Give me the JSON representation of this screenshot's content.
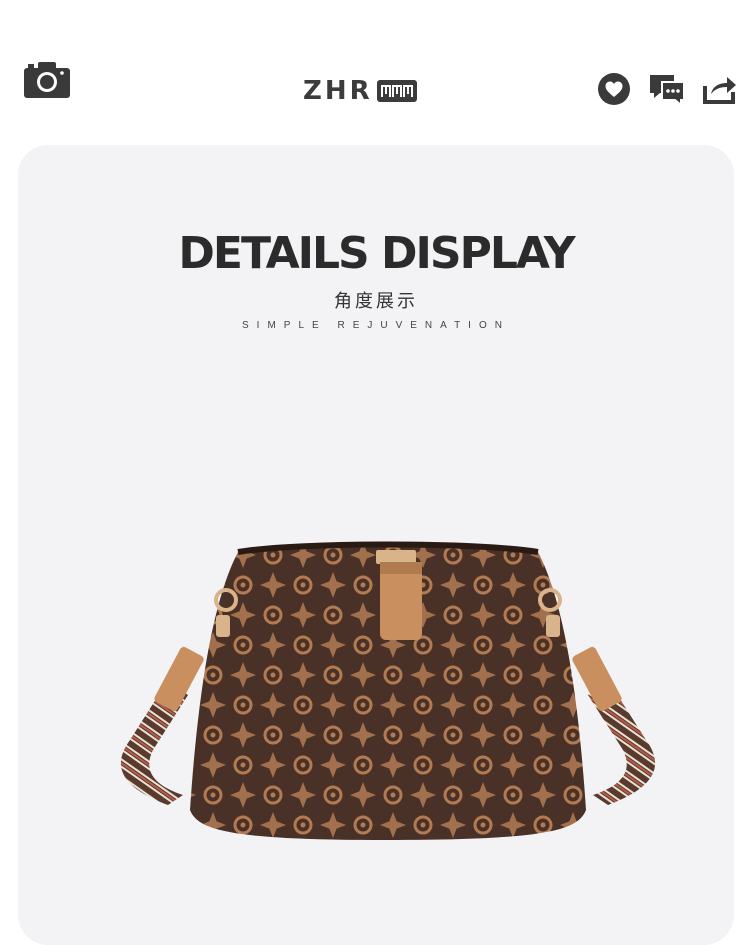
{
  "header": {
    "brand_text": "ZHR",
    "brand_mark": "ZHR logo mark",
    "icons": [
      "camera-icon",
      "heart-icon",
      "chat-icon",
      "share-icon"
    ]
  },
  "details": {
    "title": "DETAILS DISPLAY",
    "subtitle": "角度展示",
    "tagline": "SIMPLE REJUVENATION"
  },
  "colors": {
    "icon": "#3a3a3a",
    "card_bg": "#f3f3f5",
    "bag_brown": "#4a3128",
    "bag_tan": "#c98f5e",
    "hardware_gold": "#d9b38a"
  }
}
